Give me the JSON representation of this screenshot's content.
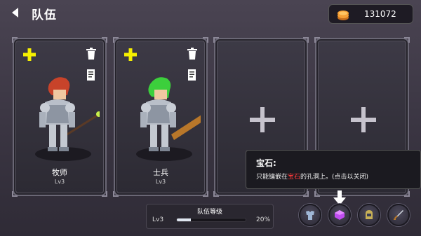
{
  "header": {
    "title": "队伍"
  },
  "currency": {
    "amount": "131072",
    "icon": "gold-coin-icon"
  },
  "cards": [
    {
      "name": "牧师",
      "level": "Lv3",
      "hair_color": "#c8432a"
    },
    {
      "name": "士兵",
      "level": "Lv3",
      "hair_color": "#3ccf3c"
    }
  ],
  "tooltip": {
    "title": "宝石:",
    "body_pre": "只能镶嵌在",
    "body_highlight": "宝石",
    "body_post": "的孔洞上。(点击以关闭)"
  },
  "team": {
    "label": "队伍等级",
    "level": "Lv3",
    "progress": 0.2,
    "percent": "20%"
  },
  "colors": {
    "gold": "#f7a035",
    "plus_yellow": "#f6f000",
    "gem_purple": "#c04cf0",
    "highlight_red": "#ff3b3b"
  }
}
